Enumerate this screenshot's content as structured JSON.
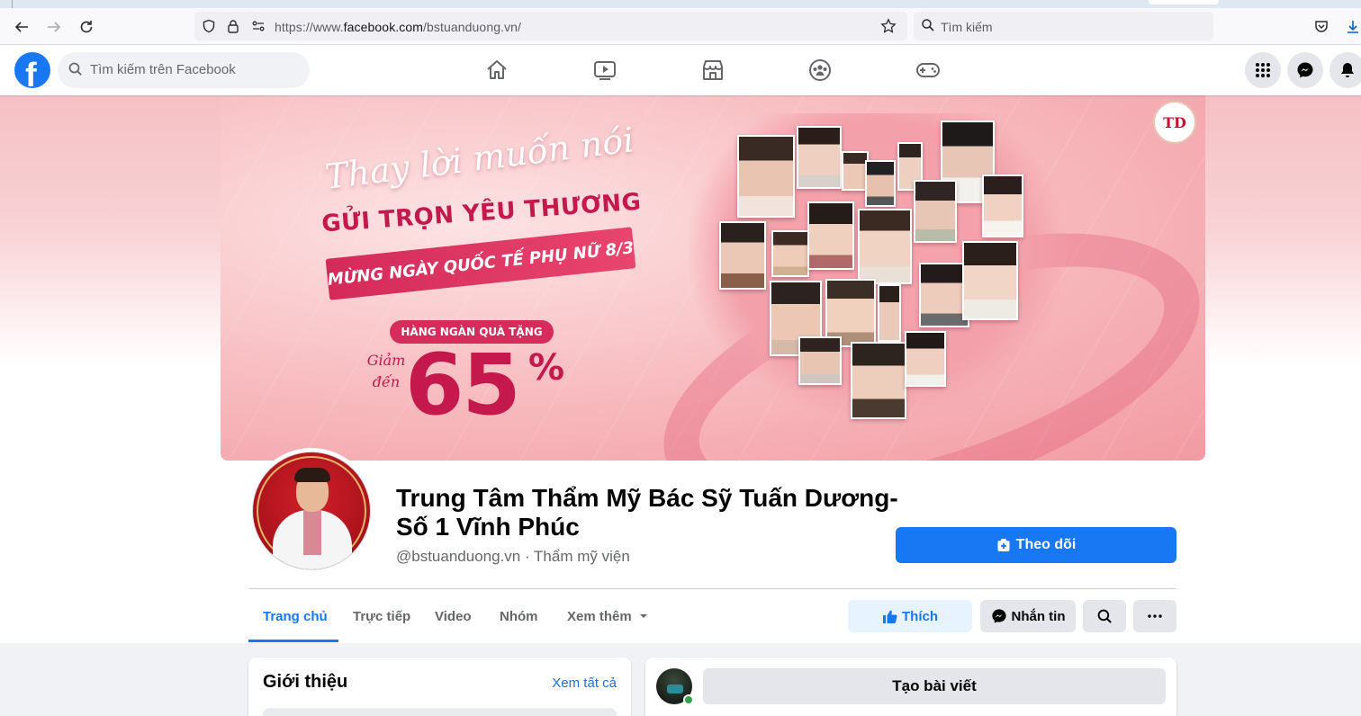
{
  "browser": {
    "url_prefix": "https://www.",
    "url_domain": "facebook.com",
    "url_path": "/bstuanduong.vn/",
    "search_placeholder": "Tìm kiếm"
  },
  "fb_header": {
    "logo_letter": "f",
    "search_placeholder": "Tìm kiếm trên Facebook",
    "nav_icons": [
      "home-icon",
      "watch-icon",
      "marketplace-icon",
      "groups-icon",
      "gaming-icon"
    ],
    "right_icons": [
      "menu-grid-icon",
      "messenger-icon",
      "notifications-icon"
    ]
  },
  "cover": {
    "headline1": "Thay lời muốn nói",
    "headline2": "GỬI TRỌN YÊU THƯƠNG",
    "ribbon": "MỪNG NGÀY QUỐC TẾ PHỤ NỮ 8/3",
    "pill": "HÀNG NGÀN QUÀ TẶNG",
    "giam_line1": "Giảm",
    "giam_line2": "đến",
    "discount": "65",
    "percent": "%",
    "logo_text": "TD"
  },
  "profile": {
    "name_line1": "Trung Tâm Thẩm Mỹ Bác Sỹ Tuấn Dương-",
    "name_line2": "Số 1 Vĩnh Phúc",
    "subtitle": "@bstuanduong.vn · Thẩm mỹ viện",
    "follow_label": "Theo dõi"
  },
  "tabs": [
    {
      "label": "Trang chủ",
      "active": true
    },
    {
      "label": "Trực tiếp"
    },
    {
      "label": "Video"
    },
    {
      "label": "Nhóm"
    },
    {
      "label": "Xem thêm"
    }
  ],
  "actions": {
    "like": "Thích",
    "message": "Nhắn tin"
  },
  "intro": {
    "title": "Giới thiệu",
    "see_all": "Xem tất cả"
  },
  "composer": {
    "create_post": "Tạo bài viết"
  },
  "colors": {
    "fb_blue": "#1877f2",
    "cover_pink": "#f29aa2",
    "accent_red": "#c5184c"
  }
}
